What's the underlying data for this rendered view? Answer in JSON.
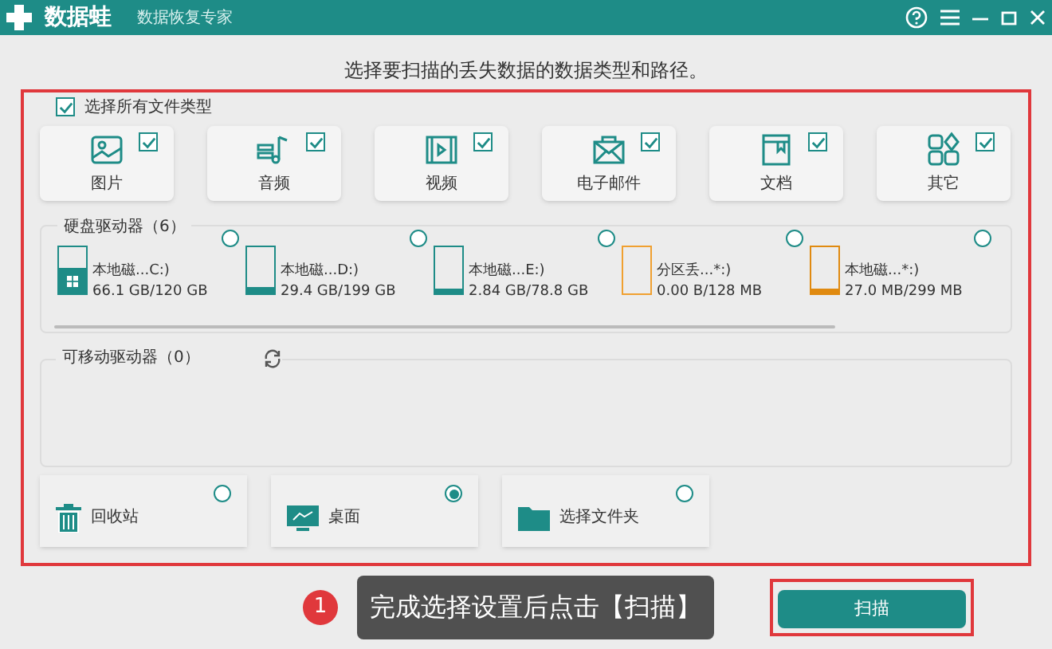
{
  "window": {
    "app_name": "数据蛙",
    "subtitle": "数据恢复专家"
  },
  "heading": "选择要扫描的丢失数据的数据类型和路径。",
  "select_all": {
    "label": "选择所有文件类型",
    "checked": true
  },
  "file_types": [
    {
      "kind": "image",
      "label": "图片",
      "checked": true
    },
    {
      "kind": "audio",
      "label": "音频",
      "checked": true
    },
    {
      "kind": "video",
      "label": "视频",
      "checked": true
    },
    {
      "kind": "email",
      "label": "电子邮件",
      "checked": true
    },
    {
      "kind": "document",
      "label": "文档",
      "checked": true
    },
    {
      "kind": "other",
      "label": "其它",
      "checked": true
    }
  ],
  "hard_drives": {
    "title": "硬盘驱动器（6）",
    "drives": [
      {
        "name": "本地磁...C:)",
        "size": "66.1 GB/120 GB",
        "level": 0.55,
        "color": "#1e8c87",
        "system": true,
        "selected": false
      },
      {
        "name": "本地磁...D:)",
        "size": "29.4 GB/199 GB",
        "level": 0.15,
        "color": "#1e8c87",
        "system": false,
        "selected": false
      },
      {
        "name": "本地磁...E:)",
        "size": "2.84 GB/78.8 GB",
        "level": 0.04,
        "color": "#1e8c87",
        "system": false,
        "selected": false
      },
      {
        "name": "分区丢...*:)",
        "size": "0.00  B/128 MB",
        "level": 0,
        "color": "#f0a030",
        "system": false,
        "selected": false
      },
      {
        "name": "本地磁...*:)",
        "size": "27.0 MB/299 MB",
        "level": 0.1,
        "color": "#e08a10",
        "system": false,
        "selected": false
      }
    ]
  },
  "removable_drives": {
    "title": "可移动驱动器（0）"
  },
  "locations": [
    {
      "kind": "recycle",
      "label": "回收站",
      "selected": false
    },
    {
      "kind": "desktop",
      "label": "桌面",
      "selected": true
    },
    {
      "kind": "folder",
      "label": "选择文件夹",
      "selected": false
    }
  ],
  "callout": {
    "number": "1",
    "text": "完成选择设置后点击【扫描】"
  },
  "scan_button": "扫描"
}
